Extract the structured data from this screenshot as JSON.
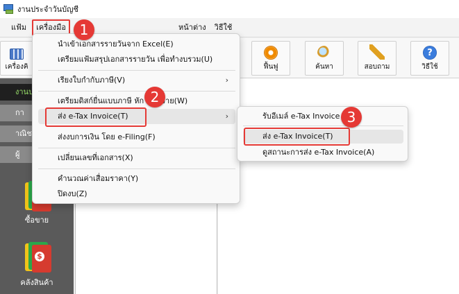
{
  "window": {
    "title": "งานประจำวันบัญชี"
  },
  "menubar": {
    "file": "แฟ้ม",
    "tools": "เครื่องมือ",
    "window": "หน้าต่าง",
    "help": "วิธีใช้"
  },
  "toolbar": {
    "first": "เครื่องคิ",
    "restore": "ฟื้นฟู",
    "search": "ค้นหา",
    "inquiry": "สอบถาม",
    "help": "วิธีใช้"
  },
  "sidebar": {
    "headers": [
      "งานบ",
      "กา",
      "าณิชย์อิ",
      "ผู้"
    ],
    "items": [
      {
        "label": "ซื้อขาย",
        "icon": "books-icon"
      },
      {
        "label": "คลังสินค้า",
        "icon": "books-dollar-icon"
      }
    ]
  },
  "tools_menu": {
    "items": [
      {
        "label": "นำเข้าเอกสารรายวันจาก Excel(E)"
      },
      {
        "label": "เตรียมแฟ้มสรุปเอกสารรายวัน เพื่อทำงบรวม(U)"
      },
      {
        "label": "เรียงใบกำกับภาษี(V)",
        "submenu": true
      },
      {
        "label": "เตรียมดิสก์ยื่นแบบภาษี หัก ณ ที่จ่าย(W)"
      },
      {
        "label": "ส่ง e-Tax Invoice(T)",
        "submenu": true
      },
      {
        "label": "ส่งงบการเงิน โดย e-Filing(F)"
      },
      {
        "label": "เปลี่ยนเลขที่เอกสาร(X)"
      },
      {
        "label": "คำนวณค่าเสื่อมราคา(Y)"
      },
      {
        "label": "ปิดงบ(Z)"
      }
    ]
  },
  "etax_submenu": {
    "items": [
      {
        "label": "รับอีเมล์ e-Tax Invoice"
      },
      {
        "label": "ส่ง e-Tax Invoice(T)"
      },
      {
        "label": "ดูสถานะการส่ง e-Tax Invoice(A)"
      }
    ]
  },
  "badges": [
    "1",
    "2",
    "3"
  ],
  "colors": {
    "highlight": "#e53935",
    "sidebar": "#5a5a5a"
  }
}
